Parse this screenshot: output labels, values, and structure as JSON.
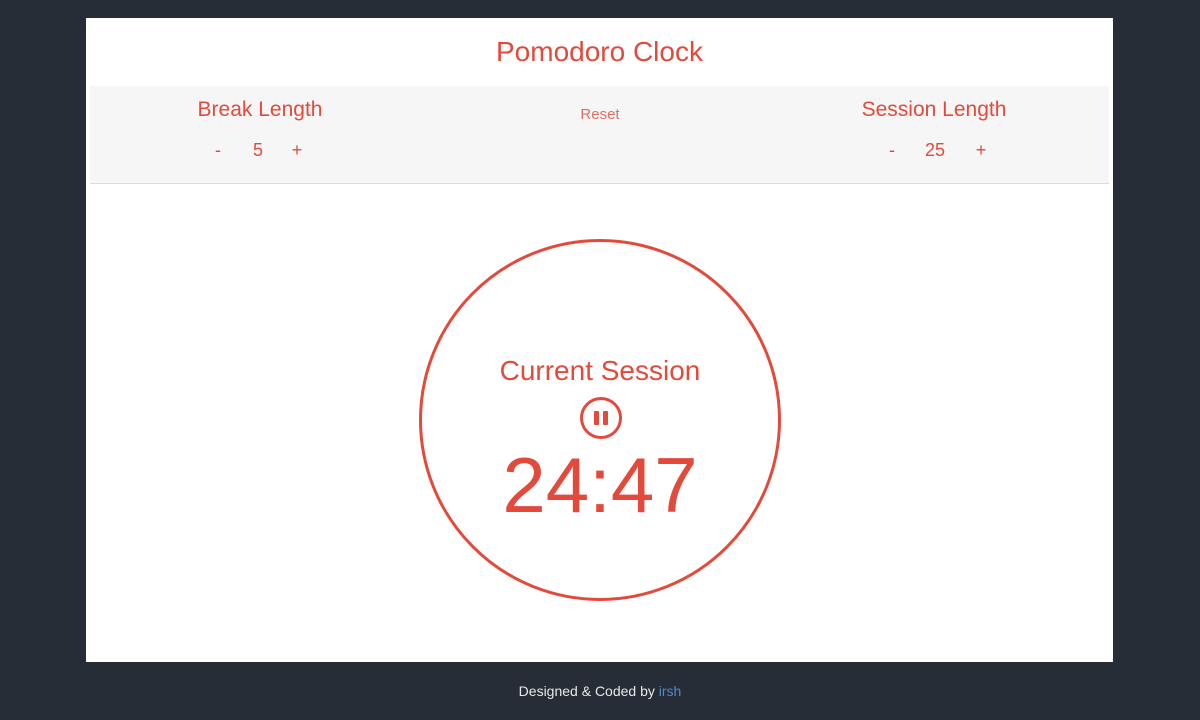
{
  "app": {
    "title": "Pomodoro Clock"
  },
  "controls": {
    "break_label": "Break Length",
    "break_minus": "-",
    "break_value": "5",
    "break_plus": "+",
    "reset_label": "Reset",
    "session_label": "Session Length",
    "session_minus": "-",
    "session_value": "25",
    "session_plus": "+"
  },
  "clock": {
    "status": "Current Session",
    "time": "24:47",
    "state_icon": "pause-icon"
  },
  "footer": {
    "text": "Designed & Coded by ",
    "author": "irsh"
  },
  "colors": {
    "background": "#262d36",
    "card": "#ffffff",
    "accent": "#e24a3b",
    "panel": "#f6f6f6",
    "link": "#4a8bd6"
  }
}
